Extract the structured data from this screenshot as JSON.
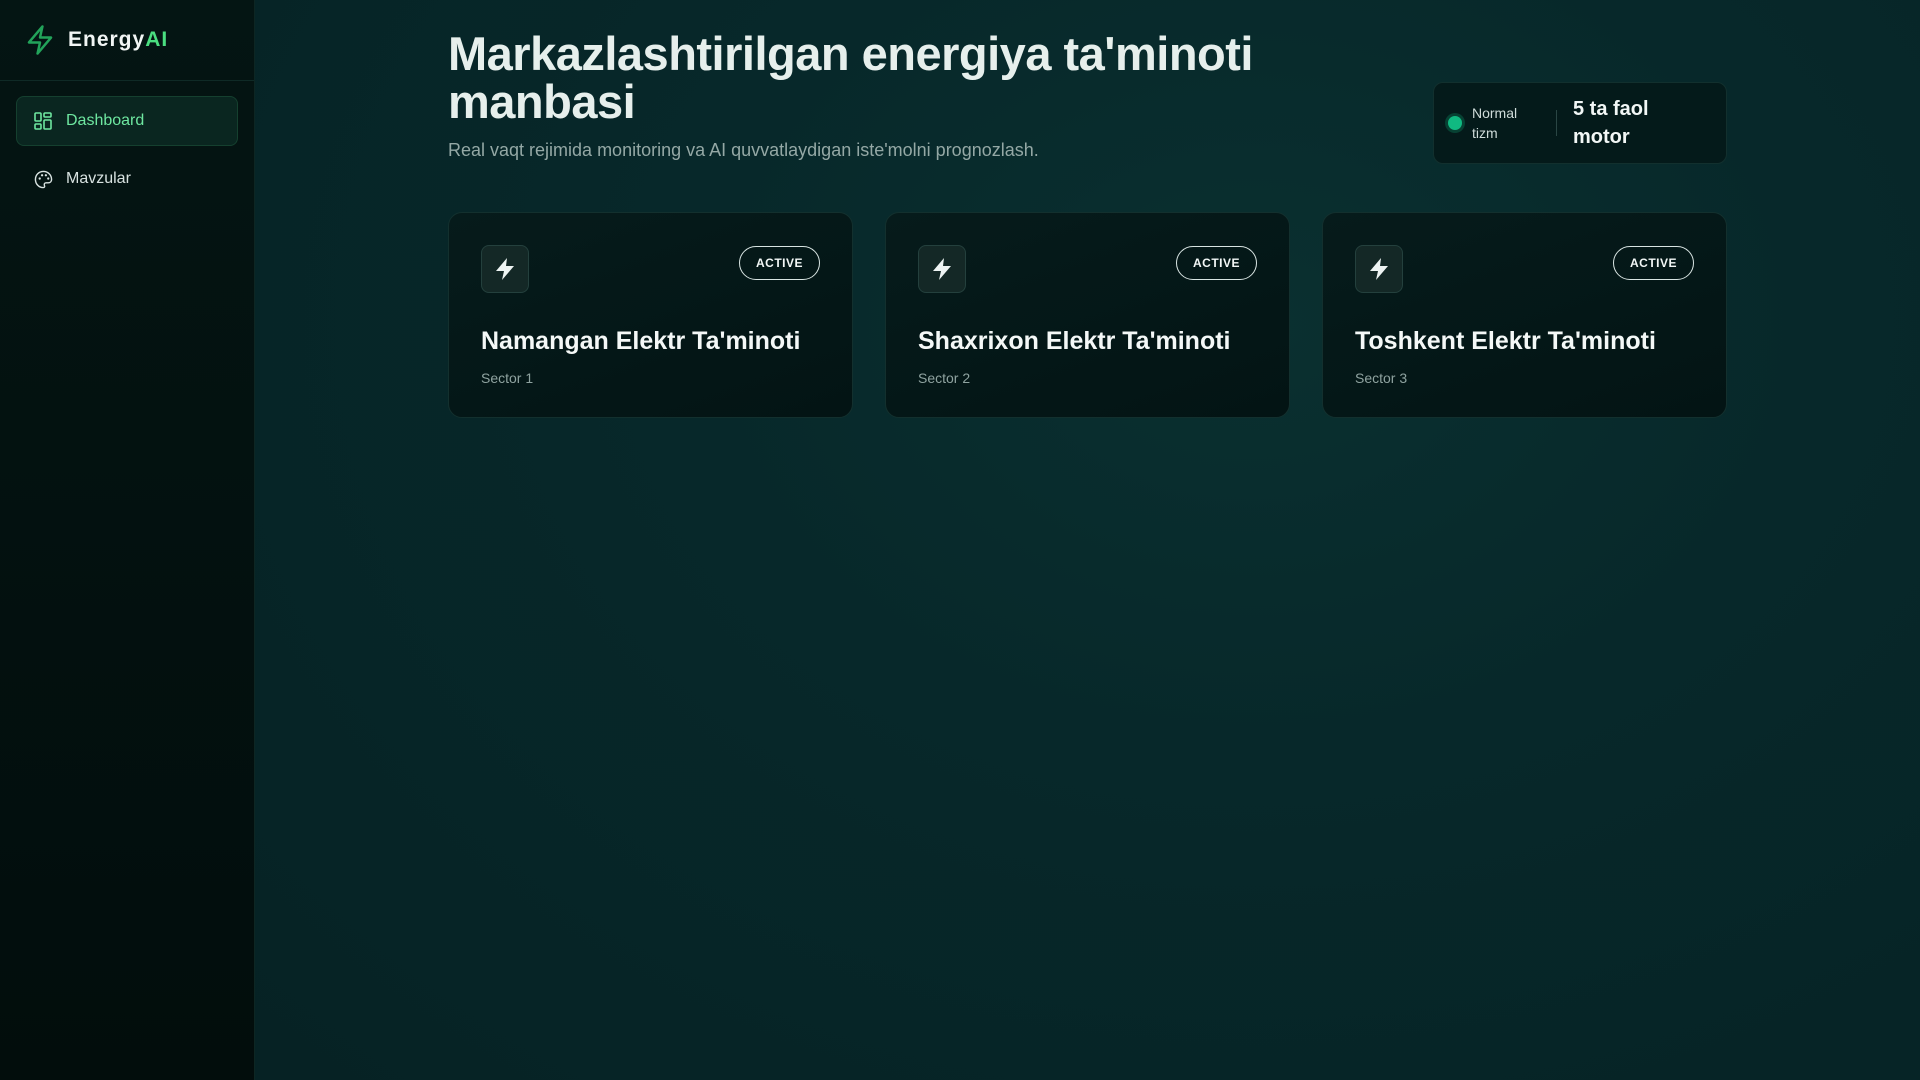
{
  "brand": {
    "name_main": "Energy",
    "name_accent": "AI",
    "accent_color": "#4ade80"
  },
  "sidebar": {
    "items": [
      {
        "label": "Dashboard",
        "icon": "dashboard-grid-icon",
        "active": true
      },
      {
        "label": "Mavzular",
        "icon": "palette-icon",
        "active": false
      }
    ]
  },
  "header": {
    "title": "Markazlashtirilgan energiya ta'minoti manbasi",
    "subtitle": "Real vaqt rejimida monitoring va AI quvvatlaydigan iste'molni prognozlash."
  },
  "status": {
    "label": "Normal tizm",
    "count": "5 ta faol motor",
    "color": "#10b981"
  },
  "cards": [
    {
      "title": "Namangan Elektr Ta'minoti",
      "sector": "Sector 1",
      "badge": "ACTIVE",
      "icon": "lightning-bolt-icon"
    },
    {
      "title": "Shaxrixon Elektr Ta'minoti",
      "sector": "Sector 2",
      "badge": "ACTIVE",
      "icon": "lightning-bolt-icon"
    },
    {
      "title": "Toshkent Elektr Ta'minoti",
      "sector": "Sector 3",
      "badge": "ACTIVE",
      "icon": "lightning-bolt-icon"
    }
  ]
}
